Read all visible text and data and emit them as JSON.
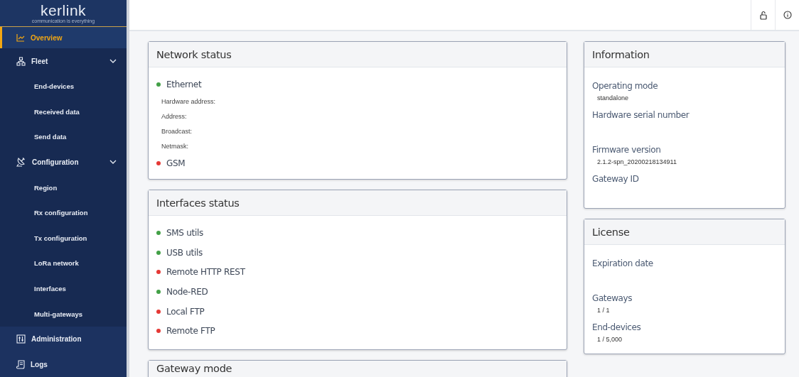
{
  "sidebar": {
    "logo": {
      "name": "kerlink",
      "tagline": "communication is everything"
    },
    "items": [
      {
        "label": "Overview",
        "selected": true
      },
      {
        "label": "Fleet",
        "selected": false,
        "expanded": true,
        "children": [
          {
            "label": "End-devices",
            "selected": false
          },
          {
            "label": "Received data",
            "selected": false
          },
          {
            "label": "Send data",
            "selected": false
          }
        ]
      },
      {
        "label": "Configuration",
        "selected": false,
        "expanded": true,
        "children": [
          {
            "label": "Region",
            "selected": false
          },
          {
            "label": "Rx configuration",
            "selected": false
          },
          {
            "label": "Tx configuration",
            "selected": false
          },
          {
            "label": "LoRa network",
            "selected": false
          },
          {
            "label": "Interfaces",
            "selected": false
          },
          {
            "label": "Multi-gateways",
            "selected": false
          }
        ]
      },
      {
        "label": "Administration",
        "selected": false
      },
      {
        "label": "Logs",
        "selected": false
      }
    ]
  },
  "network_status": {
    "title": "Network status",
    "items": [
      {
        "label": "Ethernet",
        "color": "#43a047",
        "details": [
          "Hardware address:",
          "Address:",
          "Broadcast:",
          "Netmask:"
        ]
      },
      {
        "label": "GSM",
        "color": "#e53935"
      }
    ]
  },
  "interfaces_status": {
    "title": "Interfaces status",
    "items": [
      {
        "label": "SMS utils",
        "color": "#43a047"
      },
      {
        "label": "USB utils",
        "color": "#43a047"
      },
      {
        "label": "Remote HTTP REST",
        "color": "#e53935"
      },
      {
        "label": "Node-RED",
        "color": "#43a047"
      },
      {
        "label": "Local FTP",
        "color": "#e53935"
      },
      {
        "label": "Remote FTP",
        "color": "#e53935"
      }
    ]
  },
  "gateway_mode": {
    "title": "Gateway mode"
  },
  "information": {
    "title": "Information",
    "fields": [
      {
        "label": "Operating mode",
        "value": "standalone"
      },
      {
        "label": "Hardware serial number"
      },
      {
        "label": "Firmware version",
        "value": "2.1.2-spn_20200218134911"
      },
      {
        "label": "Gateway ID"
      }
    ]
  },
  "license": {
    "title": "License",
    "fields": [
      {
        "label": "Expiration date"
      },
      {
        "label": "Gateways",
        "value": "1 / 1"
      },
      {
        "label": "End-devices",
        "value": "1 / 5,000"
      }
    ]
  }
}
